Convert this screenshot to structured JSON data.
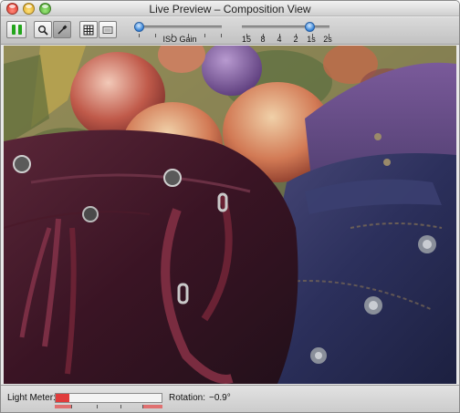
{
  "window": {
    "title": "Live Preview – Composition View"
  },
  "toolbar": {
    "buttons": [
      {
        "name": "pause",
        "icon": "pause-icon"
      },
      {
        "name": "zoom",
        "icon": "magnifier-icon"
      },
      {
        "name": "eyedropper",
        "icon": "eyedropper-icon"
      },
      {
        "name": "grid",
        "icon": "grid-icon"
      },
      {
        "name": "frame",
        "icon": "frame-icon"
      }
    ],
    "iso_gain": {
      "label": "ISO Gain"
    },
    "shutter": {
      "labels": [
        "15",
        "8",
        "4",
        "2",
        "1s",
        "2s"
      ]
    }
  },
  "status": {
    "light_meter_label": "Light Meter:",
    "light_meter_level": 0.13,
    "rotation_label": "Rotation:",
    "rotation_value": "−0.9°"
  },
  "colors": {
    "accent": "#2f7fd6",
    "pause_green": "#23a51c",
    "meter_red": "#e03c3c"
  }
}
